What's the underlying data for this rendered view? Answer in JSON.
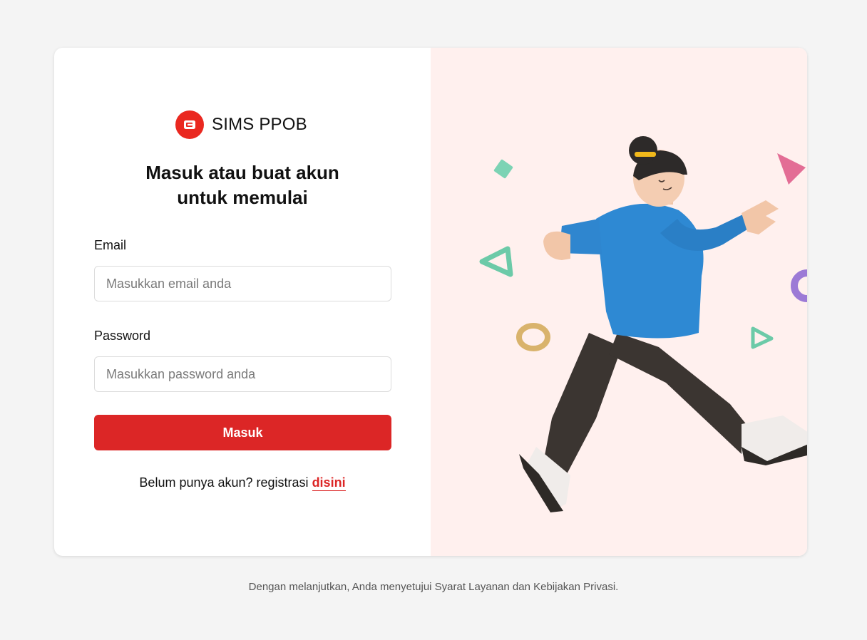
{
  "brand": {
    "name": "SIMS PPOB",
    "logo_icon": "wallet-icon",
    "color": "#ea2820"
  },
  "heading": {
    "line1": "Masuk atau buat akun",
    "line2": "untuk memulai"
  },
  "form": {
    "email_label": "Email",
    "email_placeholder": "Masukkan email anda",
    "email_value": "",
    "password_label": "Password",
    "password_placeholder": "Masukkan password anda",
    "password_value": "",
    "submit_label": "Masuk"
  },
  "register": {
    "prefix": "Belum punya akun? registrasi ",
    "link_label": "disini"
  },
  "footer": {
    "text": "Dengan melanjutkan, Anda menyetujui Syarat Layanan dan Kebijakan Privasi."
  },
  "colors": {
    "accent": "#dc2626",
    "illustration_bg": "#fff0ee",
    "page_bg": "#f4f4f4"
  }
}
